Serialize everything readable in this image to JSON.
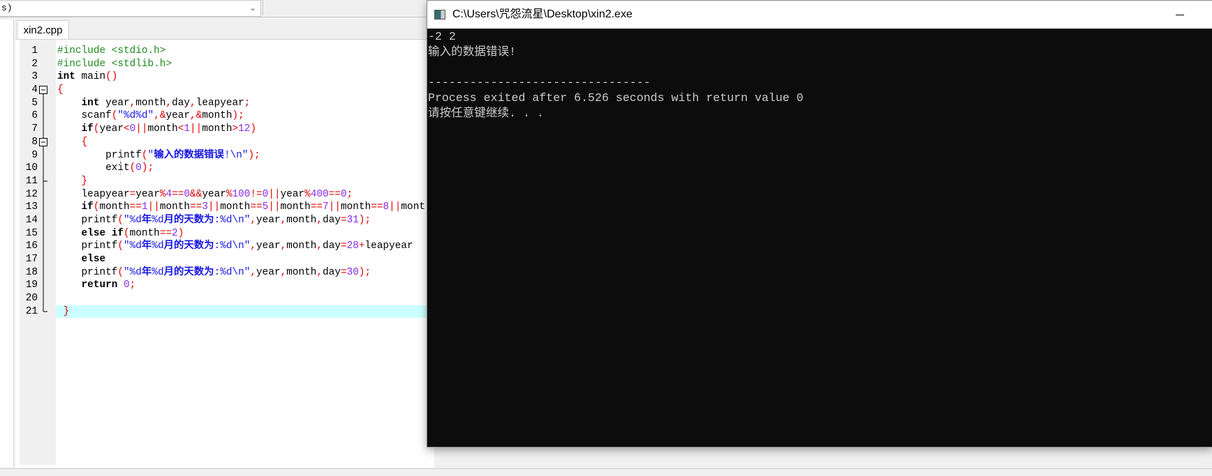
{
  "toolbar": {
    "combo_text": "s)",
    "chevron_icon": "chevron-down-icon"
  },
  "editor": {
    "tab_label": "xin2.cpp",
    "current_line": 21,
    "colors": {
      "current_line_bg": "#ccffff",
      "keyword": "#000000",
      "preprocessor": "#1e8a1e",
      "symbol": "#e00000",
      "number": "#8a2be2",
      "string": "#1818e0"
    },
    "lines": [
      {
        "n": "1",
        "fold": "",
        "tokens": [
          [
            "pp",
            "#include <stdio.h>"
          ]
        ]
      },
      {
        "n": "2",
        "fold": "",
        "tokens": [
          [
            "pp",
            "#include <stdlib.h>"
          ]
        ]
      },
      {
        "n": "3",
        "fold": "",
        "tokens": [
          [
            "kw",
            "int"
          ],
          [
            "id",
            " main"
          ],
          [
            "sym",
            "()"
          ]
        ]
      },
      {
        "n": "4",
        "fold": "open",
        "tokens": [
          [
            "sym",
            "{"
          ]
        ]
      },
      {
        "n": "5",
        "fold": "bar",
        "tokens": [
          [
            "id",
            "    "
          ],
          [
            "kw",
            "int"
          ],
          [
            "id",
            " year"
          ],
          [
            "sym",
            ","
          ],
          [
            "id",
            "month"
          ],
          [
            "sym",
            ","
          ],
          [
            "id",
            "day"
          ],
          [
            "sym",
            ","
          ],
          [
            "id",
            "leapyear"
          ],
          [
            "sym",
            ";"
          ]
        ]
      },
      {
        "n": "6",
        "fold": "bar",
        "tokens": [
          [
            "id",
            "    scanf"
          ],
          [
            "sym",
            "("
          ],
          [
            "str",
            "\"%d%d\""
          ],
          [
            "sym",
            ",&"
          ],
          [
            "id",
            "year"
          ],
          [
            "sym",
            ",&"
          ],
          [
            "id",
            "month"
          ],
          [
            "sym",
            ");"
          ]
        ]
      },
      {
        "n": "7",
        "fold": "bar",
        "tokens": [
          [
            "id",
            "    "
          ],
          [
            "kw",
            "if"
          ],
          [
            "sym",
            "("
          ],
          [
            "id",
            "year"
          ],
          [
            "sym",
            "<"
          ],
          [
            "num",
            "0"
          ],
          [
            "sym",
            "||"
          ],
          [
            "id",
            "month"
          ],
          [
            "sym",
            "<"
          ],
          [
            "num",
            "1"
          ],
          [
            "sym",
            "||"
          ],
          [
            "id",
            "month"
          ],
          [
            "sym",
            ">"
          ],
          [
            "num",
            "12"
          ],
          [
            "sym",
            ")"
          ]
        ]
      },
      {
        "n": "8",
        "fold": "open",
        "tokens": [
          [
            "id",
            "    "
          ],
          [
            "sym",
            "{"
          ]
        ]
      },
      {
        "n": "9",
        "fold": "bar",
        "guide": true,
        "tokens": [
          [
            "id",
            "        printf"
          ],
          [
            "sym",
            "("
          ],
          [
            "str",
            "\""
          ],
          [
            "strb",
            "输入的数据错误"
          ],
          [
            "str",
            "!\\n\""
          ],
          [
            "sym",
            ");"
          ]
        ]
      },
      {
        "n": "10",
        "fold": "bar",
        "guide": true,
        "tokens": [
          [
            "id",
            "        exit"
          ],
          [
            "sym",
            "("
          ],
          [
            "num",
            "0"
          ],
          [
            "sym",
            ");"
          ]
        ]
      },
      {
        "n": "11",
        "fold": "end",
        "tokens": [
          [
            "id",
            "    "
          ],
          [
            "sym",
            "}"
          ]
        ]
      },
      {
        "n": "12",
        "fold": "bar",
        "tokens": [
          [
            "id",
            "    leapyear"
          ],
          [
            "sym",
            "="
          ],
          [
            "id",
            "year"
          ],
          [
            "sym",
            "%"
          ],
          [
            "num",
            "4"
          ],
          [
            "sym",
            "=="
          ],
          [
            "num",
            "0"
          ],
          [
            "sym",
            "&&"
          ],
          [
            "id",
            "year"
          ],
          [
            "sym",
            "%"
          ],
          [
            "num",
            "100"
          ],
          [
            "sym",
            "!="
          ],
          [
            "num",
            "0"
          ],
          [
            "sym",
            "||"
          ],
          [
            "id",
            "year"
          ],
          [
            "sym",
            "%"
          ],
          [
            "num",
            "400"
          ],
          [
            "sym",
            "=="
          ],
          [
            "num",
            "0"
          ],
          [
            "sym",
            ";"
          ]
        ]
      },
      {
        "n": "13",
        "fold": "bar",
        "tokens": [
          [
            "id",
            "    "
          ],
          [
            "kw",
            "if"
          ],
          [
            "sym",
            "("
          ],
          [
            "id",
            "month"
          ],
          [
            "sym",
            "=="
          ],
          [
            "num",
            "1"
          ],
          [
            "sym",
            "||"
          ],
          [
            "id",
            "month"
          ],
          [
            "sym",
            "=="
          ],
          [
            "num",
            "3"
          ],
          [
            "sym",
            "||"
          ],
          [
            "id",
            "month"
          ],
          [
            "sym",
            "=="
          ],
          [
            "num",
            "5"
          ],
          [
            "sym",
            "||"
          ],
          [
            "id",
            "month"
          ],
          [
            "sym",
            "=="
          ],
          [
            "num",
            "7"
          ],
          [
            "sym",
            "||"
          ],
          [
            "id",
            "month"
          ],
          [
            "sym",
            "=="
          ],
          [
            "num",
            "8"
          ],
          [
            "sym",
            "||"
          ],
          [
            "id",
            "mont"
          ]
        ]
      },
      {
        "n": "14",
        "fold": "bar",
        "tokens": [
          [
            "id",
            "    printf"
          ],
          [
            "sym",
            "("
          ],
          [
            "str",
            "\"%d"
          ],
          [
            "strb",
            "年"
          ],
          [
            "str",
            "%d"
          ],
          [
            "strb",
            "月的天数为"
          ],
          [
            "str",
            ":%d\\n\""
          ],
          [
            "sym",
            ","
          ],
          [
            "id",
            "year"
          ],
          [
            "sym",
            ","
          ],
          [
            "id",
            "month"
          ],
          [
            "sym",
            ","
          ],
          [
            "id",
            "day"
          ],
          [
            "sym",
            "="
          ],
          [
            "num",
            "31"
          ],
          [
            "sym",
            ");"
          ]
        ]
      },
      {
        "n": "15",
        "fold": "bar",
        "tokens": [
          [
            "id",
            "    "
          ],
          [
            "kw",
            "else if"
          ],
          [
            "sym",
            "("
          ],
          [
            "id",
            "month"
          ],
          [
            "sym",
            "=="
          ],
          [
            "num",
            "2"
          ],
          [
            "sym",
            ")"
          ]
        ]
      },
      {
        "n": "16",
        "fold": "bar",
        "tokens": [
          [
            "id",
            "    printf"
          ],
          [
            "sym",
            "("
          ],
          [
            "str",
            "\"%d"
          ],
          [
            "strb",
            "年"
          ],
          [
            "str",
            "%d"
          ],
          [
            "strb",
            "月的天数为"
          ],
          [
            "str",
            ":%d\\n\""
          ],
          [
            "sym",
            ","
          ],
          [
            "id",
            "year"
          ],
          [
            "sym",
            ","
          ],
          [
            "id",
            "month"
          ],
          [
            "sym",
            ","
          ],
          [
            "id",
            "day"
          ],
          [
            "sym",
            "="
          ],
          [
            "num",
            "28"
          ],
          [
            "sym",
            "+"
          ],
          [
            "id",
            "leapyear"
          ]
        ]
      },
      {
        "n": "17",
        "fold": "bar",
        "tokens": [
          [
            "id",
            "    "
          ],
          [
            "kw",
            "else"
          ]
        ]
      },
      {
        "n": "18",
        "fold": "bar",
        "tokens": [
          [
            "id",
            "    printf"
          ],
          [
            "sym",
            "("
          ],
          [
            "str",
            "\"%d"
          ],
          [
            "strb",
            "年"
          ],
          [
            "str",
            "%d"
          ],
          [
            "strb",
            "月的天数为"
          ],
          [
            "str",
            ":%d\\n\""
          ],
          [
            "sym",
            ","
          ],
          [
            "id",
            "year"
          ],
          [
            "sym",
            ","
          ],
          [
            "id",
            "month"
          ],
          [
            "sym",
            ","
          ],
          [
            "id",
            "day"
          ],
          [
            "sym",
            "="
          ],
          [
            "num",
            "30"
          ],
          [
            "sym",
            ");"
          ]
        ]
      },
      {
        "n": "19",
        "fold": "bar",
        "tokens": [
          [
            "id",
            "    "
          ],
          [
            "kw",
            "return"
          ],
          [
            "id",
            " "
          ],
          [
            "num",
            "0"
          ],
          [
            "sym",
            ";"
          ]
        ]
      },
      {
        "n": "20",
        "fold": "bar",
        "tokens": []
      },
      {
        "n": "21",
        "fold": "end",
        "tokens": [
          [
            "id",
            " "
          ],
          [
            "sym",
            "}"
          ]
        ]
      }
    ]
  },
  "console": {
    "title": "C:\\Users\\咒怨流星\\Desktop\\xin2.exe",
    "icon": "console-window-icon",
    "minimize_icon": "minimize-icon",
    "colors": {
      "bg": "#0c0c0c",
      "fg": "#cccccc"
    },
    "lines": [
      "-2 2",
      "输入的数据错误!",
      "",
      "--------------------------------",
      "Process exited after 6.526 seconds with return value 0",
      "请按任意键继续. . ."
    ]
  }
}
